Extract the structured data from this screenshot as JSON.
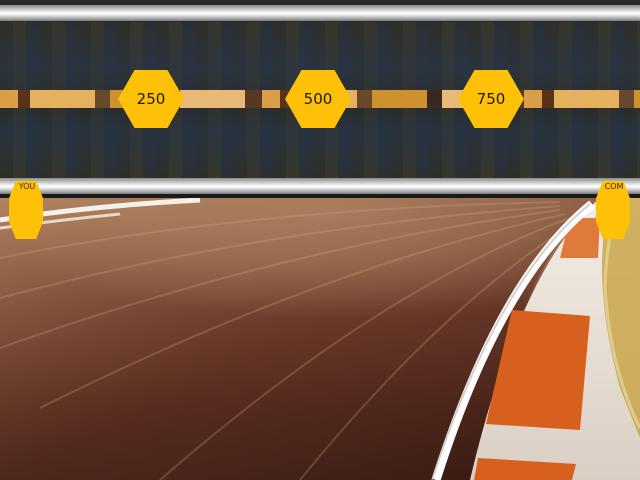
{
  "milestones": {
    "first": "250",
    "second": "500",
    "third": "750"
  },
  "racers": {
    "player_label": "YOU",
    "opponent_label": "COM"
  },
  "colors": {
    "marker": "#ffc107",
    "rail": "#f2f2f2",
    "asphalt": "#2b2b2d",
    "curb_orange": "#d8601f",
    "curb_white": "#efe8e0"
  }
}
